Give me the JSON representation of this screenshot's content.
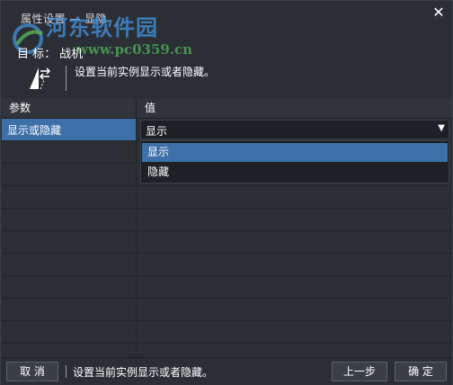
{
  "window": {
    "title": "属性设置 — 显隐",
    "close_glyph": "✕"
  },
  "watermark": {
    "site_name": "河东软件园",
    "url": "www.pc0359.cn"
  },
  "target": {
    "label": "目 标：",
    "value": "战机"
  },
  "description": "设置当前实例显示或者隐藏。",
  "table": {
    "headers": [
      "参数",
      "值"
    ],
    "rows": [
      {
        "param": "显示或隐藏",
        "value": "显示",
        "active": true
      }
    ],
    "empty_rows": 10
  },
  "select": {
    "current": "显示",
    "arrow": "▼",
    "options": [
      "显示",
      "隐藏"
    ],
    "highlighted": "显示"
  },
  "footer": {
    "cancel_label": "取 消",
    "description": "设置当前实例显示或者隐藏。",
    "prev_label": "上一步",
    "ok_label": "确 定"
  },
  "colors": {
    "background": "#2b2f35",
    "selection": "#3d6fa8",
    "input_bg": "#1d2024"
  },
  "icons": [
    "close-icon",
    "swap-icon",
    "dropdown-arrow-icon",
    "watermark-logo-icon"
  ]
}
